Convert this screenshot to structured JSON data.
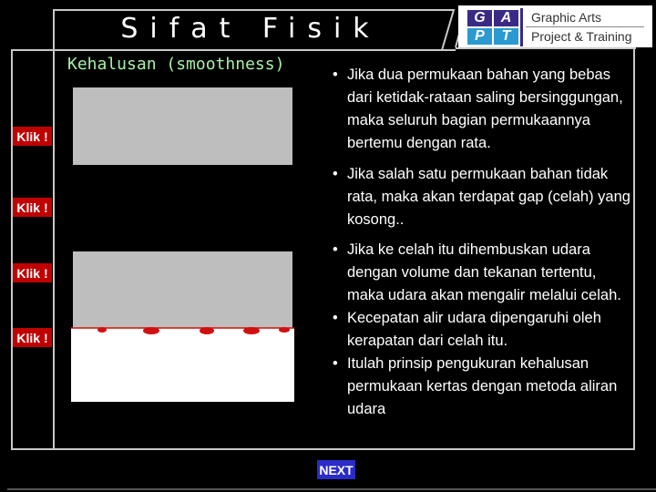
{
  "header": {
    "title": "Sifat Fisik",
    "logo": {
      "cells": [
        "G",
        "A",
        "P",
        "T"
      ],
      "line1": "Graphic Arts",
      "line2": "Project & Training",
      "colors": {
        "purple": "#3a2a86",
        "blue": "#2a9ad0"
      }
    }
  },
  "section": {
    "subtitle": "Kehalusan (smoothness)"
  },
  "sidebar": {
    "klik_buttons": [
      "Klik !",
      "Klik !",
      "Klik !",
      "Klik !"
    ],
    "button_color": "#c00000"
  },
  "content": {
    "bullets": [
      "Jika dua permukaan bahan yang bebas dari ketidak-rataan saling bersinggungan, maka seluruh bagian permukaannya bertemu dengan rata.",
      "Jika salah satu permukaan bahan tidak rata, maka akan terdapat gap (celah) yang kosong..",
      "Jika ke celah itu dihembuskan udara dengan volume dan tekanan tertentu, maka udara akan mengalir melalui celah.",
      "Kecepatan alir udara dipengaruhi oleh kerapatan dari celah itu.",
      "Itulah prinsip pengukuran kehalusan permukaan kertas dengan metoda aliran udara"
    ]
  },
  "navigation": {
    "next_label": "NEXT",
    "next_color": "#2b2bc9"
  }
}
